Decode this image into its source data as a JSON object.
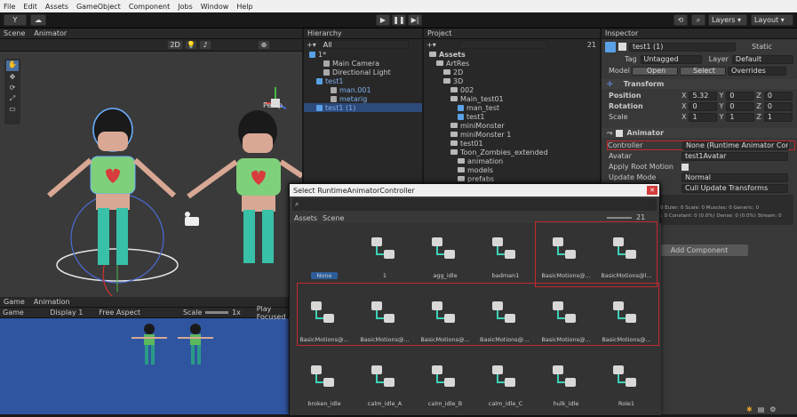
{
  "menubar": [
    "File",
    "Edit",
    "Assets",
    "GameObject",
    "Component",
    "Jobs",
    "Window",
    "Help"
  ],
  "toolbar": {
    "account": "Y",
    "layers": "Layers",
    "layout": "Layout"
  },
  "scene": {
    "tabs": [
      "Scene",
      "Animator"
    ],
    "mode_2d": "2D",
    "persp_label": "Persp"
  },
  "game": {
    "tabs": [
      "Game",
      "Animation"
    ],
    "display_mode": "Game",
    "display": "Display 1",
    "aspect": "Free Aspect",
    "scale_label": "Scale",
    "scale_value": "1x",
    "play_focused": "Play Focused"
  },
  "hierarchy": {
    "title": "Hierarchy",
    "search": "All",
    "items": [
      {
        "label": "1*",
        "indent": 0
      },
      {
        "label": "Main Camera",
        "indent": 2
      },
      {
        "label": "Directional Light",
        "indent": 2
      },
      {
        "label": "test1",
        "indent": 1
      },
      {
        "label": "man.001",
        "indent": 3
      },
      {
        "label": "metarig",
        "indent": 3
      },
      {
        "label": "test1 (1)",
        "indent": 1
      }
    ]
  },
  "project": {
    "title": "Project",
    "count": "21",
    "items": [
      {
        "label": "Assets",
        "indent": 0
      },
      {
        "label": "ArtRes",
        "indent": 1
      },
      {
        "label": "2D",
        "indent": 2
      },
      {
        "label": "3D",
        "indent": 2
      },
      {
        "label": "002",
        "indent": 3
      },
      {
        "label": "Main_test01",
        "indent": 3
      },
      {
        "label": "man_test",
        "indent": 4
      },
      {
        "label": "test1",
        "indent": 4
      },
      {
        "label": "miniMonster",
        "indent": 3
      },
      {
        "label": "miniMonster 1",
        "indent": 3
      },
      {
        "label": "test01",
        "indent": 3
      },
      {
        "label": "Toon_Zombies_extended",
        "indent": 3
      },
      {
        "label": "animation",
        "indent": 4
      },
      {
        "label": "models",
        "indent": 4
      },
      {
        "label": "prefabs",
        "indent": 4
      },
      {
        "label": "sample scene",
        "indent": 4
      }
    ]
  },
  "inspector": {
    "title": "Inspector",
    "object_name": "test1 (1)",
    "static_label": "Static",
    "tag_label": "Tag",
    "tag_value": "Untagged",
    "layer_label": "Layer",
    "layer_value": "Default",
    "model_label": "Model",
    "open_btn": "Open",
    "select_btn": "Select",
    "overrides": "Overrides",
    "transform": {
      "title": "Transform",
      "position": [
        "5.32",
        "0",
        "0"
      ],
      "rotation": [
        "0",
        "0",
        "0"
      ],
      "scale": [
        "1",
        "1",
        "1"
      ],
      "labels": [
        "Position",
        "Rotation",
        "Scale"
      ],
      "axes": [
        "X",
        "Y",
        "Z"
      ]
    },
    "animator": {
      "title": "Animator",
      "controller_label": "Controller",
      "controller_value": "None (Runtime Animator Controller)",
      "avatar_label": "Avatar",
      "avatar_value": "test1Avatar",
      "root_motion_label": "Apply Root Motion",
      "update_label": "Update Mode",
      "update_value": "Normal",
      "culling_label": "Culling Mode",
      "culling_value": "Cull Update Transforms",
      "info1": "Clip Count: 0",
      "info2": "Curves Pos: 0 Quat: 0 Euler: 0 Scale: 0 Muscles: 0 Generic: 0",
      "info3": "PPtr: 0 Curves Count: 0 Constant: 0 (0.0%) Dense: 0 (0.0%) Stream: 0"
    },
    "add_component": "Add Component"
  },
  "dialog": {
    "title": "Select RuntimeAnimatorController",
    "tabs": [
      "Assets",
      "Scene"
    ],
    "count": "21",
    "items": [
      "None",
      "1",
      "agg_idle",
      "badman1",
      "BasicMotions@...",
      "BasicMotions@l...",
      "BasicMotions@...",
      "BasicMotions@...",
      "BasicMotions@...",
      "BasicMotions@S...",
      "BasicMotions@...",
      "BasicMotions@...",
      "broken_idle",
      "calm_idle_A",
      "calm_idle_B",
      "calm_idle_C",
      "hulk_idle",
      "Role1"
    ]
  }
}
